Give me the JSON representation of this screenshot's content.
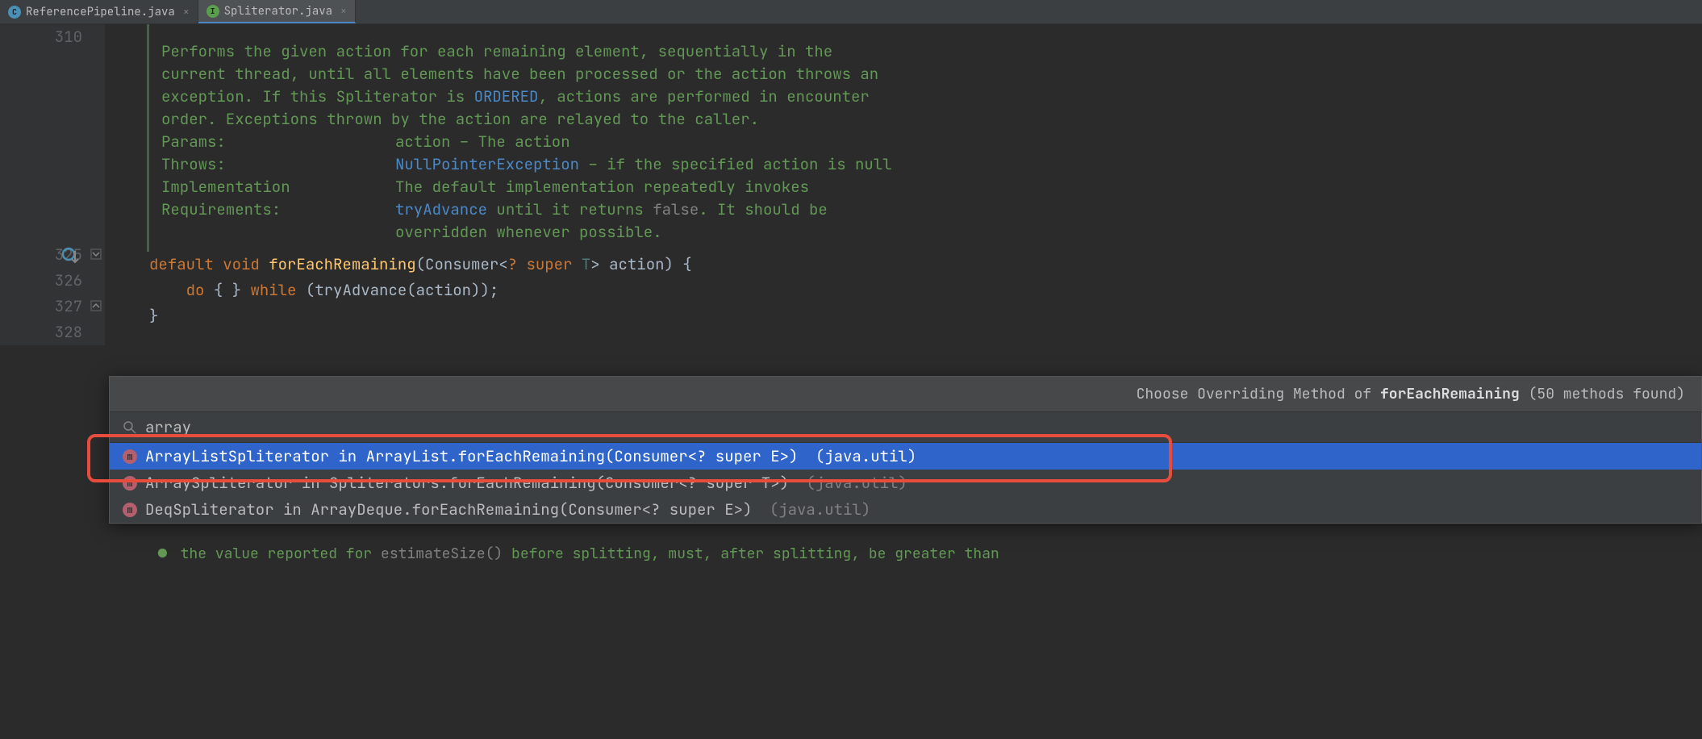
{
  "tabs": [
    {
      "icon": "C",
      "label": "ReferencePipeline.java",
      "active": false
    },
    {
      "icon": "I",
      "label": "Spliterator.java",
      "active": true
    }
  ],
  "gutter": {
    "lines": [
      "310",
      "325",
      "326",
      "327",
      "328"
    ]
  },
  "javadoc": {
    "desc_pre": "Performs the given action for each remaining element, sequentially in the current thread, until all elements have been processed or the action throws an exception. If this Spliterator is ",
    "desc_link": "ORDERED",
    "desc_post": ", actions are performed in encounter order. Exceptions thrown by the action are relayed to the caller.",
    "params_label": "Params:",
    "params_text": "action – The action",
    "throws_label": "Throws:",
    "throws_link": "NullPointerException",
    "throws_text": " – if the specified action is null",
    "impl_label": "Implementation Requirements:",
    "impl_pre": "The default implementation repeatedly invokes ",
    "impl_link": "tryAdvance",
    "impl_mid": " until it returns ",
    "impl_false": "false",
    "impl_post": ". It should be overridden whenever possible."
  },
  "code": {
    "l325_default": "default",
    "l325_void": "void",
    "l325_method": "forEachRemaining",
    "l325_sig_open": "(Consumer<",
    "l325_q": "?",
    "l325_super": "super",
    "l325_t": "T",
    "l325_sig_close": "> action) {",
    "l326_do": "do",
    "l326_block": " { } ",
    "l326_while": "while",
    "l326_cond": " (tryAdvance(action));",
    "l327_close": "}"
  },
  "popup": {
    "header_pre": "Choose Overriding Method of ",
    "header_method": "forEachRemaining",
    "header_count": " (50 methods found)",
    "search_value": "array",
    "items": [
      {
        "text": "ArrayListSpliterator in ArrayList.forEachRemaining(Consumer<? super E>) ",
        "pkg": "(java.util)",
        "selected": true
      },
      {
        "text": "ArraySpliterator in Spliterators.forEachRemaining(Consumer<? super T>) ",
        "pkg": "(java.util)",
        "selected": false
      },
      {
        "text": "DeqSpliterator in ArrayDeque.forEachRemaining(Consumer<? super E>) ",
        "pkg": "(java.util)",
        "selected": false
      }
    ]
  },
  "extra_doc": {
    "bullet": "●",
    "text_pre": " the value reported for ",
    "code": "estimateSize()",
    "text_post": " before splitting, must, after splitting, be greater than"
  }
}
